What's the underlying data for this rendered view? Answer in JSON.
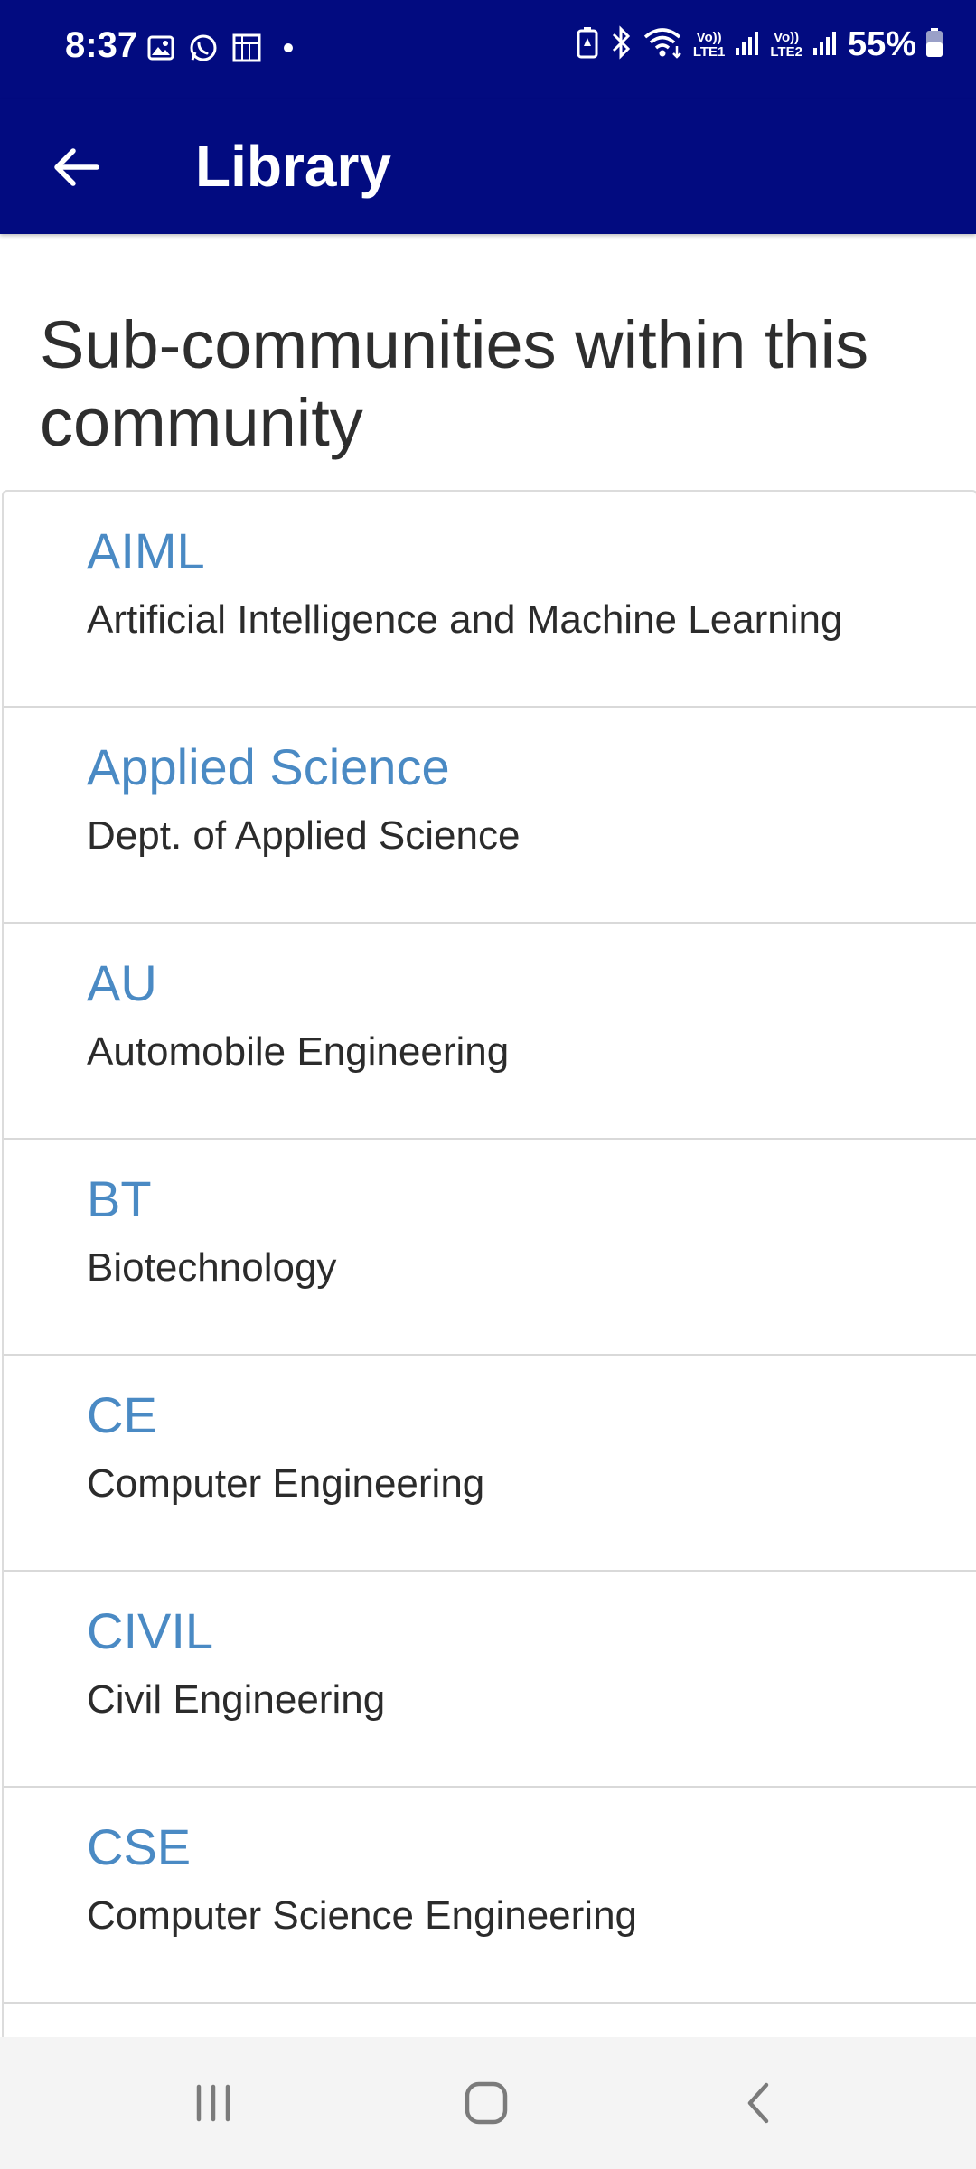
{
  "status_bar": {
    "time": "8:37",
    "battery_percent": "55%",
    "sim1_label": "LTE1",
    "sim2_label": "LTE2",
    "icons": [
      "gallery-icon",
      "whatsapp-icon",
      "app-notification-icon",
      "dot-icon",
      "battery-saver-icon",
      "bluetooth-icon",
      "wifi-icon",
      "signal-icon",
      "battery-icon"
    ]
  },
  "app_bar": {
    "title": "Library",
    "back_icon": "arrow-left-icon"
  },
  "section": {
    "heading": "Sub-communities within this community"
  },
  "communities": [
    {
      "name": "AIML",
      "description": "Artificial Intelligence and Machine Learning"
    },
    {
      "name": "Applied Science",
      "description": "Dept. of Applied Science"
    },
    {
      "name": "AU",
      "description": "Automobile Engineering"
    },
    {
      "name": "BT",
      "description": "Biotechnology"
    },
    {
      "name": "CE",
      "description": "Computer Engineering"
    },
    {
      "name": "CIVIL",
      "description": "Civil Engineering"
    },
    {
      "name": "CSE",
      "description": "Computer Science Engineering"
    }
  ],
  "nav_bar": {
    "buttons": [
      "recents-icon",
      "home-icon",
      "back-icon"
    ]
  },
  "colors": {
    "nav_bg": "#020b80",
    "link": "#4a8ac4",
    "text": "#2b2b2b"
  }
}
